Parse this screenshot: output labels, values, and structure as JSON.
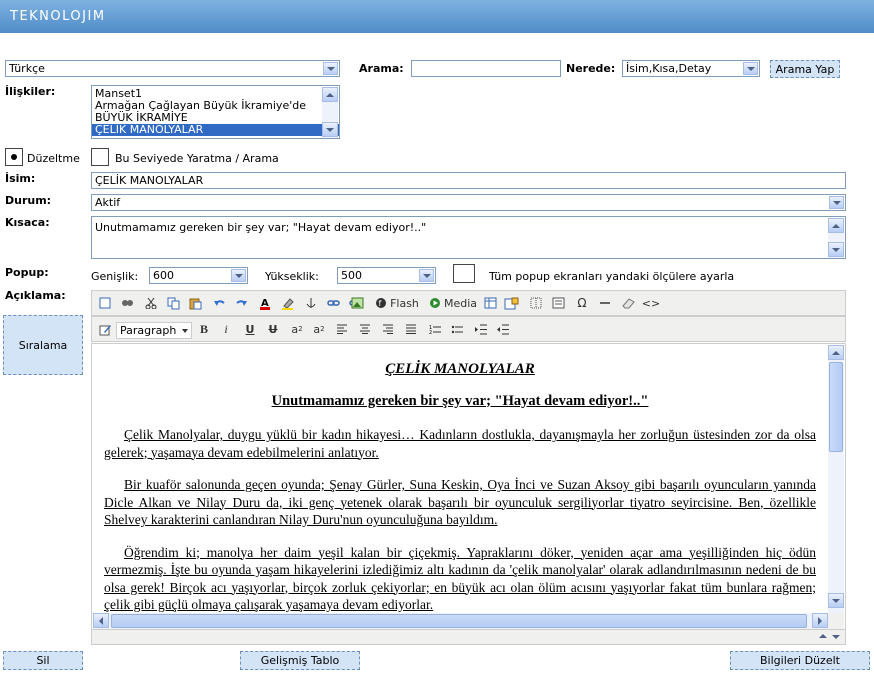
{
  "app": {
    "logo": "TEKNOLOJIM"
  },
  "language": {
    "selected": "Türkçe"
  },
  "search": {
    "label": "Arama:",
    "value": "",
    "where_label": "Nerede:",
    "where_selected": "İsim,Kısa,Detay",
    "button": "Arama Yap"
  },
  "relations": {
    "label": "İlişkiler:",
    "items": [
      "Manset1",
      "Armağan Çağlayan Büyük İkramiye'de",
      "BÜYÜK İKRAMİYE",
      "ÇELİK MANOLYALAR"
    ],
    "selected_index": 3
  },
  "mode": {
    "edit_label": "Düzeltme",
    "create_label": "Bu Seviyede Yaratma / Arama",
    "selected": "Düzeltme"
  },
  "name": {
    "label": "İsim:",
    "value": "ÇELİK MANOLYALAR"
  },
  "status": {
    "label": "Durum:",
    "selected": "Aktif"
  },
  "short": {
    "label": "Kısaca:",
    "value": "Unutmamamız gereken bir şey var; \"Hayat devam ediyor!..\""
  },
  "popup": {
    "label": "Popup:",
    "width_label": "Genişlik:",
    "width_value": "600",
    "height_label": "Yükseklik:",
    "height_value": "500",
    "all_label": "Tüm popup ekranları yandaki ölçülere ayarla",
    "all_checked": false
  },
  "description": {
    "label": "Açıklama:"
  },
  "sort_button": "Sıralama",
  "editor": {
    "toolbar": {
      "flash_label": "Flash",
      "media_label": "Media",
      "format_selected": "Paragraph",
      "icons": [
        "new-document-icon",
        "find-icon",
        "cut-icon",
        "copy-icon",
        "paste-icon",
        "undo-icon",
        "redo-icon",
        "text-color-icon",
        "highlight-icon",
        "anchor-icon",
        "link-icon",
        "image-icon",
        "flash-icon",
        "media-icon",
        "table-icon",
        "insert-object-icon",
        "visual-aid-icon",
        "select-all-icon",
        "special-char-icon",
        "horizontal-rule-icon",
        "remove-format-icon",
        "html-source-icon",
        "style-icon",
        "bold-icon",
        "italic-icon",
        "underline-icon",
        "strikethrough-icon",
        "superscript-icon",
        "subscript-icon",
        "align-left-icon",
        "align-center-icon",
        "align-right-icon",
        "justify-icon",
        "numbered-list-icon",
        "bullet-list-icon",
        "indent-icon",
        "outdent-icon"
      ]
    },
    "content": {
      "title": "ÇELİK MANOLYALAR",
      "subtitle": "Unutmamamız gereken bir şey var; \"Hayat devam ediyor!..\"",
      "paragraphs": [
        "Çelik Manolyalar, duygu yüklü bir kadın hikayesi… Kadınların dostlukla, dayanışmayla her zorluğun üstesinden zor da olsa gelerek; yaşamaya devam edebilmelerini anlatıyor.",
        "Bir kuaför salonunda geçen oyunda; Şenay Gürler, Suna Keskin, Oya İnci ve Suzan Aksoy gibi başarılı oyuncuların yanında Dicle Alkan ve Nilay Duru da, iki genç yetenek olarak başarılı bir oyunculuk sergiliyorlar tiyatro seyircisine. Ben, özellikle Shelvey karakterini canlandıran Nilay Duru'nun oyunculuğuna bayıldım.",
        "Öğrendim ki; manolya her daim yeşil kalan bir çiçekmiş. Yapraklarını döker, yeniden açar ama yeşilliğinden hiç ödün vermezmiş. İşte bu oyunda yaşam hikayelerini izlediğimiz altı kadının da 'çelik manolyalar' olarak adlandırılmasının nedeni de bu olsa gerek! Birçok acı yaşıyorlar, birçok zorluk çekiyorlar; en büyük acı olan ölüm acısını yaşıyorlar fakat tüm bunlara rağmen; çelik gibi güçlü olmaya çalışarak yaşamaya devam ediyorlar."
      ]
    }
  },
  "footer": {
    "delete_button": "Sil",
    "advanced_table_button": "Gelişmiş Tablo",
    "save_button": "Bilgileri Düzelt"
  },
  "colors": {
    "header": "#5f9bd5",
    "selection": "#316ac5",
    "dashed_button": "#d4e4f7"
  }
}
